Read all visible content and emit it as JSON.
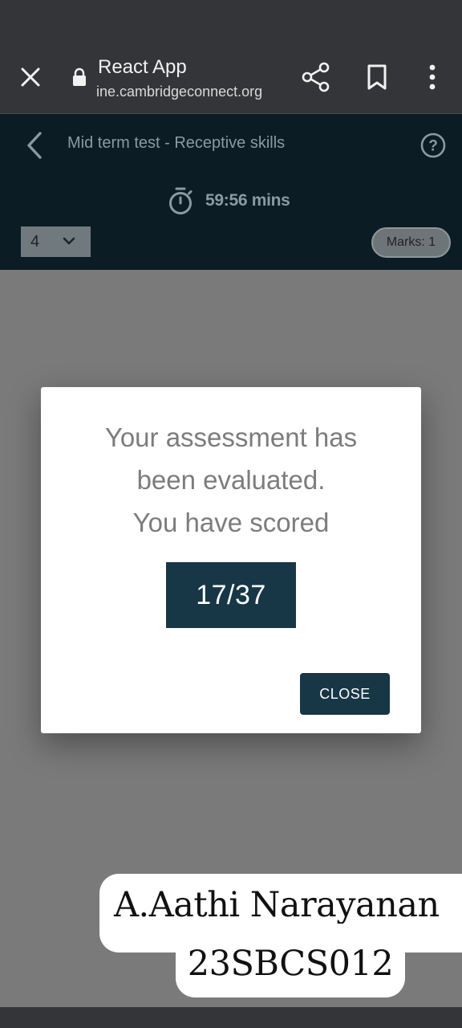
{
  "browser": {
    "page_title": "React App",
    "url": "ine.cambridgeconnect.org",
    "icons": [
      "close-icon",
      "lock-icon",
      "share-icon",
      "bookmark-icon",
      "more-vert-icon"
    ]
  },
  "header": {
    "title": "Mid term test - Receptive skills",
    "timer": "59:56 mins",
    "question_select_value": "4",
    "marks": "Marks: 1",
    "icons": [
      "back-arrow-icon",
      "help-icon",
      "stopwatch-icon",
      "chevron-down-icon"
    ]
  },
  "modal": {
    "line1": "Your assessment has",
    "line2": "been evaluated.",
    "line3": "You have scored",
    "score": "17/37",
    "close_label": "CLOSE"
  },
  "overlay": {
    "name": "A.Aathi Narayanan",
    "roll_no": "23SBCS012"
  },
  "colors": {
    "header_bg": "#0b1c24",
    "accent": "#173746",
    "dim_overlay": "#7a7a7a",
    "browser_bg": "#343538"
  }
}
